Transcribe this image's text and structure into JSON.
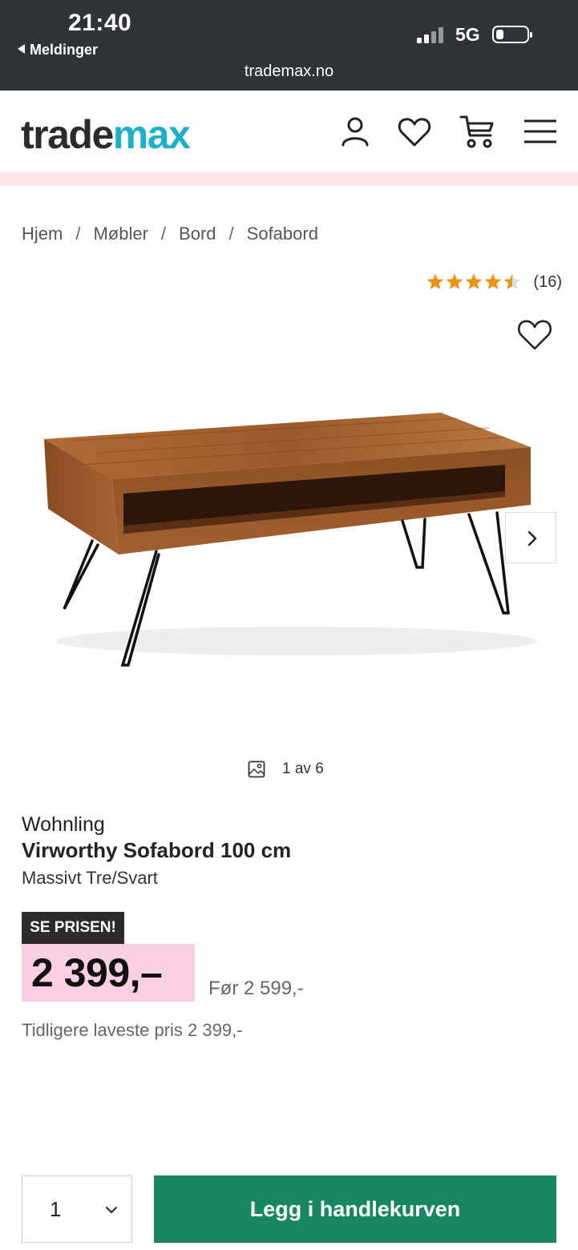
{
  "status_bar": {
    "time": "21:40",
    "back_label": "Meldinger",
    "network": "5G",
    "url": "trademax.no"
  },
  "header": {
    "logo_part1": "trade",
    "logo_part2": "max",
    "icons": [
      "user-icon",
      "heart-icon",
      "cart-icon",
      "menu-icon"
    ]
  },
  "breadcrumb": [
    "Hjem",
    "Møbler",
    "Bord",
    "Sofabord"
  ],
  "rating": {
    "stars": 4.5,
    "count": "(16)"
  },
  "gallery": {
    "counter": "1 av 6"
  },
  "product": {
    "brand": "Wohnling",
    "name": "Virworthy Sofabord 100 cm",
    "variant": "Massivt Tre/Svart",
    "badge": "SE PRISEN!",
    "price": "2 399,–",
    "before_price": "Før 2 599,-",
    "lowest_price": "Tidligere laveste pris 2 399,-"
  },
  "cart": {
    "quantity": "1",
    "add_label": "Legg i handlekurven"
  },
  "colors": {
    "status_bg": "#2f3237",
    "brand_teal": "#1cb1c6",
    "promo_pink": "#f9cfe1",
    "star_orange": "#e8951c",
    "cta_green": "#18865e"
  }
}
